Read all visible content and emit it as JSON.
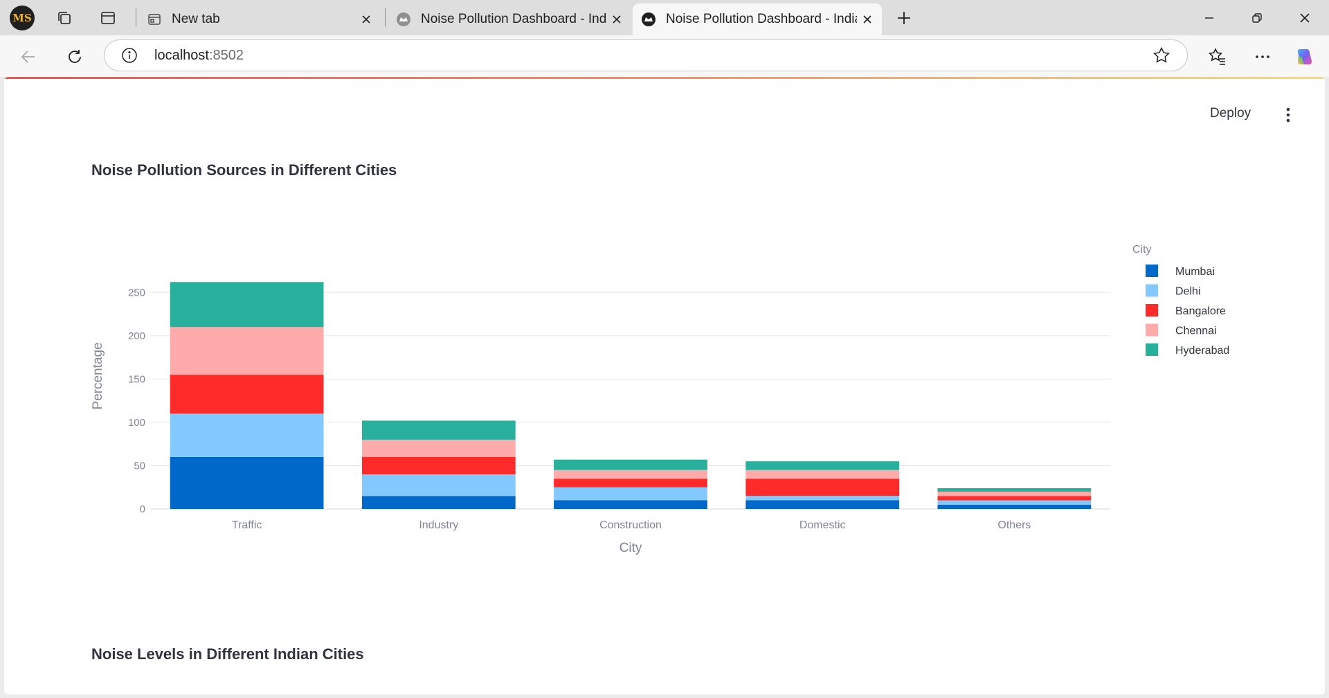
{
  "browser": {
    "tabs": [
      {
        "title": "New tab",
        "active": false
      },
      {
        "title": "Noise Pollution Dashboard - India",
        "active": false
      },
      {
        "title": "Noise Pollution Dashboard - India",
        "active": true
      }
    ],
    "url_host": "localhost",
    "url_port": ":8502"
  },
  "app": {
    "deploy_label": "Deploy",
    "section1_title": "Noise Pollution Sources in Different Cities",
    "section2_title": "Noise Levels in Different Indian Cities"
  },
  "chart_data": {
    "type": "bar",
    "stacked": true,
    "categories": [
      "Traffic",
      "Industry",
      "Construction",
      "Domestic",
      "Others"
    ],
    "series": [
      {
        "name": "Mumbai",
        "color": "#0068c9",
        "values": [
          60,
          15,
          10,
          10,
          5
        ]
      },
      {
        "name": "Delhi",
        "color": "#83c9ff",
        "values": [
          50,
          25,
          15,
          5,
          5
        ]
      },
      {
        "name": "Bangalore",
        "color": "#ff2b2b",
        "values": [
          45,
          20,
          10,
          20,
          5
        ]
      },
      {
        "name": "Chennai",
        "color": "#ffabab",
        "values": [
          55,
          20,
          10,
          10,
          5
        ]
      },
      {
        "name": "Hyderabad",
        "color": "#29b09d",
        "values": [
          52,
          22,
          12,
          10,
          4
        ]
      }
    ],
    "xlabel": "City",
    "ylabel": "Percentage",
    "legend_title": "City",
    "yticks": [
      0,
      50,
      100,
      150,
      200,
      250
    ],
    "ylim": [
      0,
      275
    ],
    "grid": true,
    "legend_position": "right"
  }
}
